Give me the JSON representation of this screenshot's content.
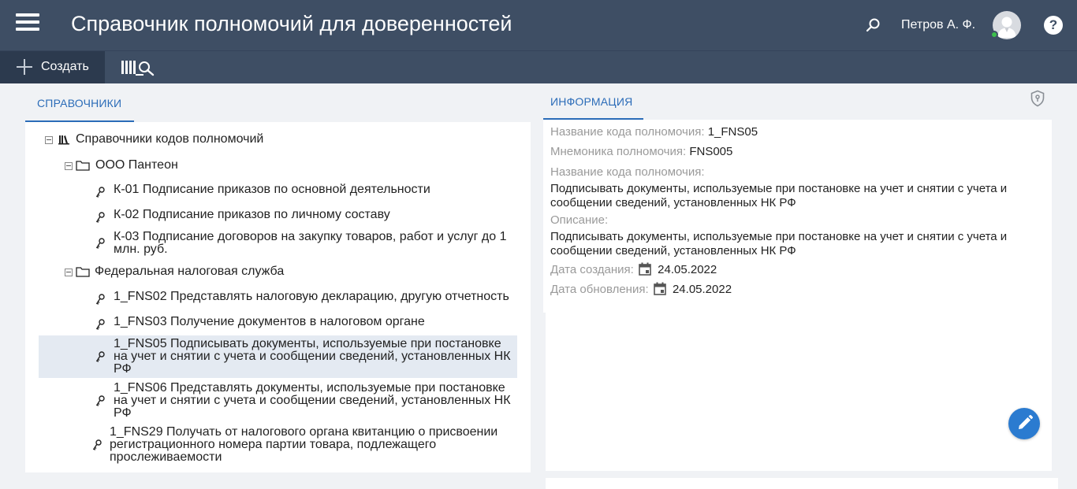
{
  "header": {
    "title": "Справочник полномочий для доверенностей",
    "user_name": "Петров А. Ф.",
    "help_label": "?"
  },
  "toolbar": {
    "create_label": "Создать"
  },
  "left": {
    "tab_label": "СПРАВОЧНИКИ",
    "tree": {
      "root_label": "Справочники кодов полномочий",
      "folders": [
        {
          "label": "ООО Пантеон",
          "items": [
            [
              "К-01 Подписание приказов по основной деятельности"
            ],
            [
              "К-02 Подписание приказов по личному составу"
            ],
            [
              "К-03 Подписание договоров на закупку товаров, работ и услуг до 1",
              "млн. руб."
            ]
          ]
        },
        {
          "label": "Федеральная налоговая служба",
          "items": [
            [
              "1_FNS02 Представлять налоговую декларацию, другую отчетность"
            ],
            [
              "1_FNS03 Получение документов в налоговом органе"
            ],
            [
              "1_FNS05 Подписывать документы, используемые при постановке",
              "на учет и снятии с учета и сообщении сведений, установленных НК",
              "РФ"
            ],
            [
              "1_FNS06 Представлять документы, используемые при постановке",
              "на учет и снятии с учета и сообщении сведений, установленных НК",
              "РФ"
            ],
            [
              "1_FNS29 Получать от налогового органа квитанцию о присвоении",
              "регистрационного номера партии товара, подлежащего",
              "прослеживаемости"
            ]
          ]
        }
      ]
    }
  },
  "right": {
    "tab_label": "ИНФОРМАЦИЯ",
    "code_name_label": "Название кода полномочия:",
    "code_name_value": "1_FNS05",
    "mnemonic_label": "Мнемоника полномочия:",
    "mnemonic_value": "FNS005",
    "name_label": "Название кода полномочия:",
    "name_lines": [
      "Подписывать документы, используемые при постановке на учет и снятии с учета и",
      "сообщении сведений, установленных НК РФ"
    ],
    "description_label": "Описание:",
    "description_lines": [
      "Подписывать документы, используемые при постановке на учет и снятии с учета и",
      "сообщении сведений, установленных НК РФ"
    ],
    "created_label": "Дата создания:",
    "created_value": "24.05.2022",
    "updated_label": "Дата обновления:",
    "updated_value": "24.05.2022"
  },
  "colors": {
    "header_bg": "#3e4e64",
    "accent": "#2b6cb8",
    "selected_row": "#e4eaf2",
    "online": "#3cc04c"
  },
  "icons": [
    "menu-icon",
    "search-icon",
    "avatar-icon",
    "help-icon",
    "plus-icon",
    "library-search-icon",
    "books-icon",
    "folder-icon",
    "key-icon",
    "shield-icon",
    "calendar-icon",
    "pencil-icon"
  ]
}
